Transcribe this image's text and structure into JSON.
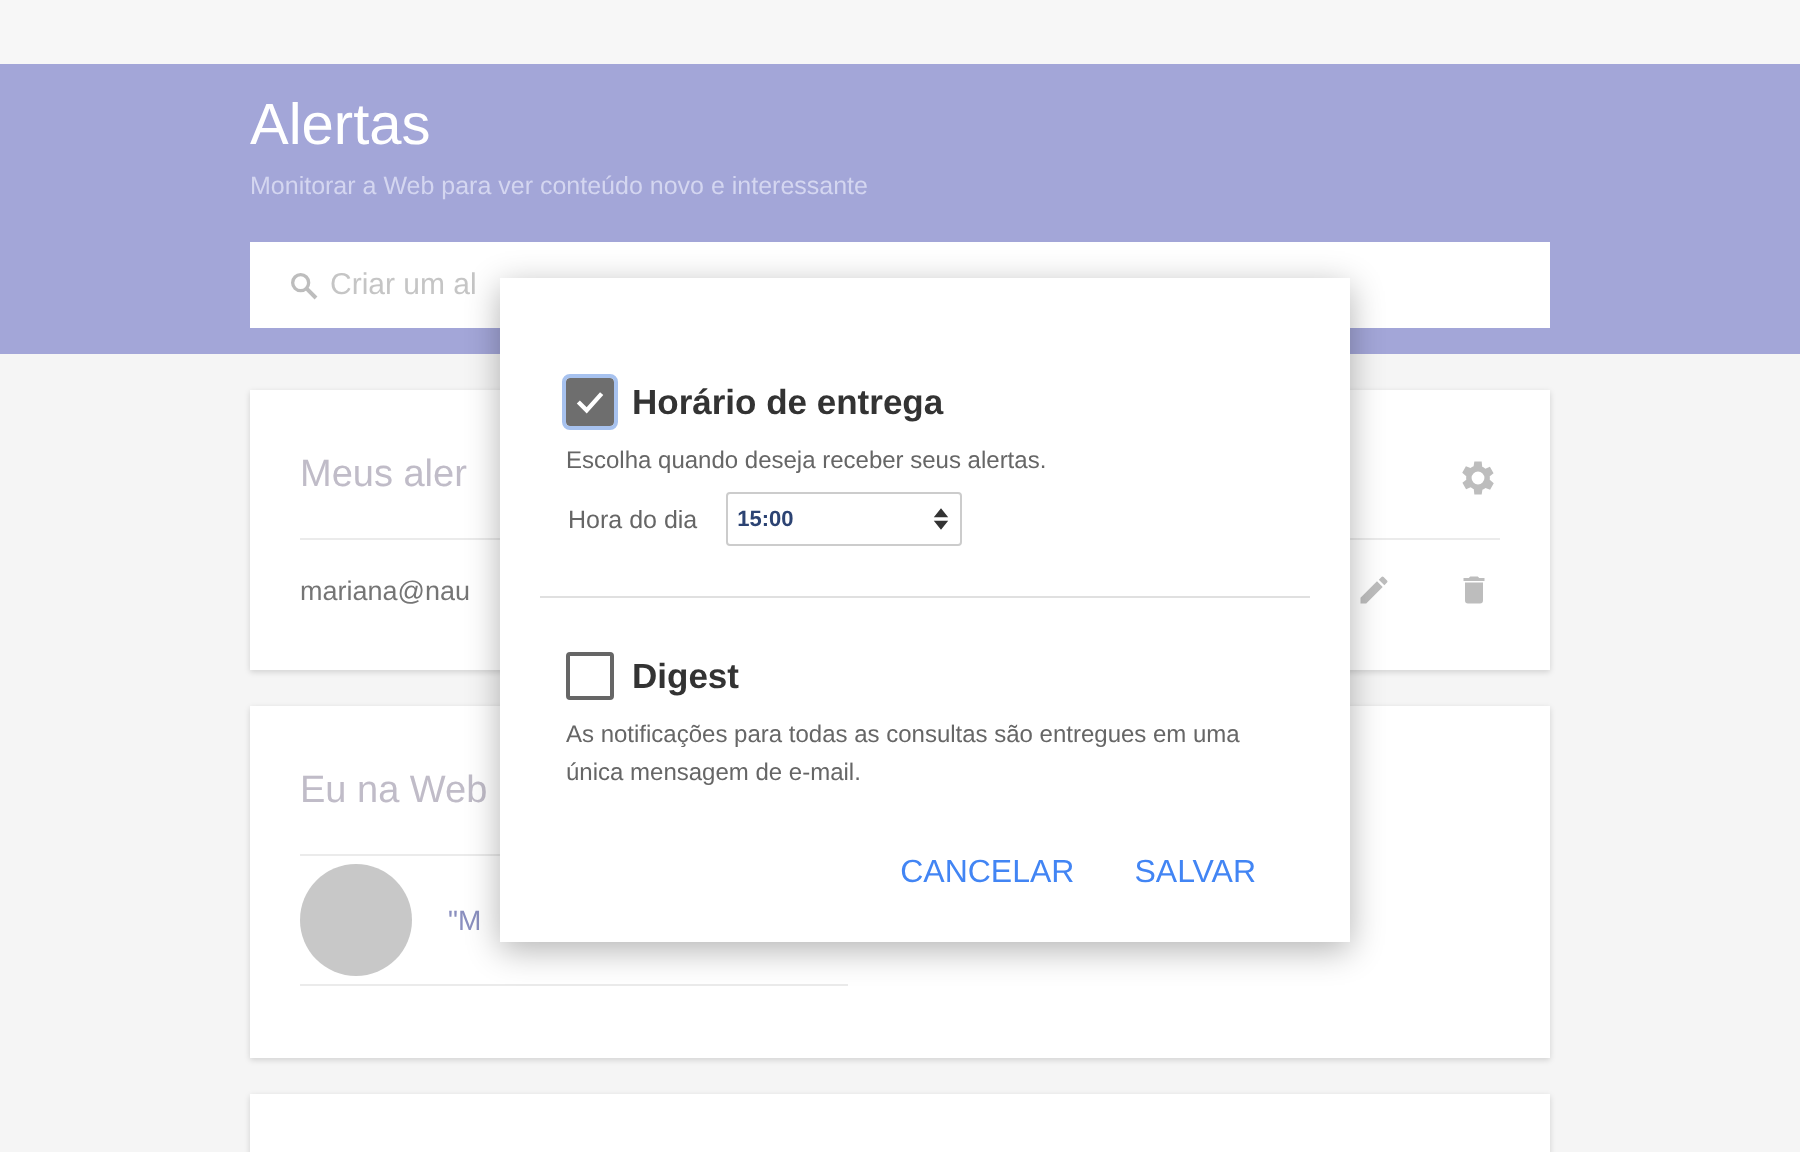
{
  "header": {
    "title": "Alertas",
    "subtitle": "Monitorar a Web para ver conteúdo novo e interessante"
  },
  "search": {
    "placeholder": "Criar um al"
  },
  "cards": [
    {
      "title": "Meus aler",
      "kind": "alerts",
      "row_text": "mariana@nau"
    },
    {
      "title": "Eu na Web",
      "kind": "me",
      "row_text": "\"M"
    }
  ],
  "dialog": {
    "options": [
      {
        "label": "Horário de entrega",
        "checked": true,
        "description": "Escolha quando deseja receber seus alertas.",
        "field_label": "Hora do dia",
        "field_value": "15:00"
      },
      {
        "label": "Digest",
        "checked": false,
        "description": "As notificações para todas as consultas são entregues em uma única mensagem de e-mail."
      }
    ],
    "buttons": [
      "CANCELAR",
      "SALVAR"
    ]
  }
}
